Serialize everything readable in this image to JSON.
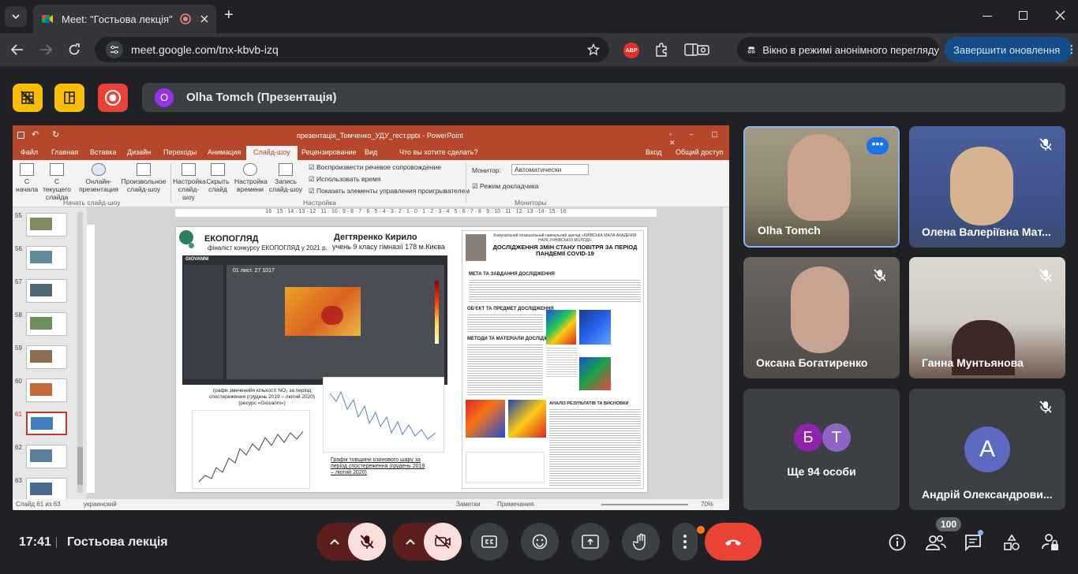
{
  "browser": {
    "tab_title": "Meet: \"Гостьова лекція\"",
    "url": "meet.google.com/tnx-kbvb-izq",
    "ext_badge": "ABP",
    "incognito_label": "Вікно в режимі анонімного перегляду",
    "update_button": "Завершити оновлення"
  },
  "meet": {
    "presenter_initial": "O",
    "presenter_label": "Olha Tomch (Презентація)",
    "time": "17:41",
    "meeting_title": "Гостьова лекція",
    "participants_count": "100"
  },
  "participants": [
    {
      "name": "Olha Tomch"
    },
    {
      "name": "Олена Валеріївна Мат..."
    },
    {
      "name": "Оксана Богатиренко"
    },
    {
      "name": "Ганна Мунтьянова"
    },
    {
      "name": "Ще 94 особи",
      "initials": [
        "Б",
        "Т"
      ]
    },
    {
      "name": "Андрій Олександрови...",
      "initial": "А"
    }
  ],
  "ppt": {
    "window_title": "презентація_Томченко_УДУ_гест.pptx - PowerPoint",
    "menu": [
      "Файл",
      "Главная",
      "Вставка",
      "Дизайн",
      "Переходы",
      "Анимация",
      "Слайд-шоу",
      "Рецензирование",
      "Вид"
    ],
    "tell_me": "Что вы хотите сделать?",
    "login": "Вход",
    "share": "Общий доступ",
    "ribbon": {
      "b1": "С начала",
      "b2": "С текущего слайда",
      "b3": "Онлайн-презентация",
      "b4": "Произвольное слайд-шоу",
      "group1": "Начать слайд-шоу",
      "b5": "Настройка слайд-шоу",
      "b6": "Скрыть слайд",
      "b7": "Настройка времени",
      "b8": "Запись слайд-шоу",
      "c1": "Воспроизвести речевое сопровождение",
      "c2": "Использовать время",
      "c3": "Показать элементы управления проигрывателем",
      "group2": "Настройка",
      "monitor_label": "Монитор:",
      "monitor_value": "Автоматически",
      "presenter_view": "Режим докладчика",
      "group3": "Мониторы"
    },
    "ruler": "16 · 15 · 14 · 13 · 12 · 11 · 10 · 9 · 8 · 7 · 6 · 5 · 4 · 3 · 2 · 1 · 0 · 1 · 2 · 3 · 4 · 5 · 6 · 7 · 8 · 9 · 10 · 11 · 12 · 13 · 14 · 15 · 16",
    "thumb_numbers": [
      "55",
      "56",
      "57",
      "58",
      "59",
      "60",
      "61",
      "62",
      "63"
    ],
    "status_slide": "Слайд 61 из 63",
    "status_lang": "украинский",
    "notes": "Заметки",
    "comments": "Примечания",
    "zoom": "70%",
    "slide": {
      "logo_title": "ЕКОПОГЛЯД",
      "subtitle": "фіналіст конкурсу ЕКОПОГЛЯД у 2021 р.",
      "author": "Дегтяренко Кирило",
      "author_info": "учень 9 класу гімназії 178 м.Києва",
      "map_brand": "GIOVANNI",
      "map_date": "01 лист. 27 1017",
      "caption1": "графік змеченийя кількості NO₂ за період спостереження (грудень 2019 – лютий 2020) (ресурс «Giovanni»)",
      "caption2": "Графік товщини озонового шару за період спостереження (грудень 2019 – лютий 2020)",
      "poster_org": "Комунальний позашкільний навчальний заклад «КИЇВСЬКА МАЛА АКАДЕМІЯ НАУК УЧНІВСЬКОЇ МОЛОДІ»",
      "poster_title": "ДОСЛІДЖЕННЯ ЗМІН СТАНУ ПОВІТРЯ ЗА ПЕРІОД ПАНДЕМІЇ COVID-19",
      "h_goal": "МЕТА ТА ЗАВДАННЯ ДОСЛІДЖЕННЯ",
      "h_object": "ОБ'ЄКТ ТА ПРЕДМЕТ ДОСЛІДЖЕННЯ",
      "h_methods": "МЕТОДИ ТА МАТЕРІАЛИ ДОСЛІДЖЕННЯ",
      "h_results": "АНАЛІЗ РЕЗУЛЬТАТІВ ТА ВИСНОВКИ"
    }
  },
  "colors": {
    "accent": "#8ab4f8",
    "leave": "#ea4335",
    "yellow": "#fbbc04",
    "ppt": "#b7472a",
    "purple": "#9334e6"
  }
}
